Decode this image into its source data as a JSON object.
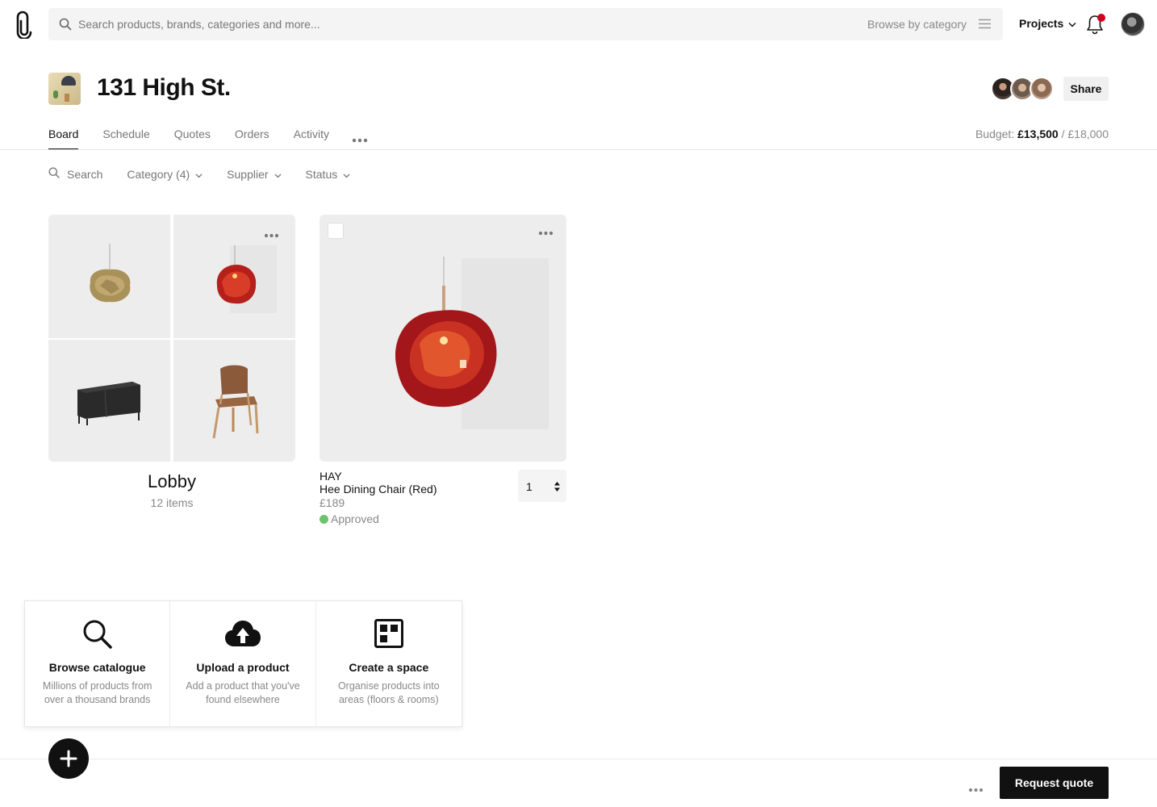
{
  "topbar": {
    "search_placeholder": "Search products, brands, categories and more...",
    "browse_label": "Browse by category",
    "projects_label": "Projects",
    "notification_dot_color": "#d0021b"
  },
  "project": {
    "title": "131 High St.",
    "share_label": "Share"
  },
  "tabs": [
    {
      "label": "Board",
      "active": true
    },
    {
      "label": "Schedule",
      "active": false
    },
    {
      "label": "Quotes",
      "active": false
    },
    {
      "label": "Orders",
      "active": false
    },
    {
      "label": "Activity",
      "active": false
    }
  ],
  "budget": {
    "label": "Budget:",
    "spent": "£13,500",
    "total": "/ £18,000"
  },
  "filters": {
    "search": "Search",
    "category": "Category (4)",
    "supplier": "Supplier",
    "status": "Status"
  },
  "lobby": {
    "title": "Lobby",
    "count": "12 items"
  },
  "product": {
    "brand": "HAY",
    "name": "Hee Dining Chair (Red)",
    "price": "£189",
    "status": "Approved",
    "status_color": "#6bc46b",
    "quantity": "1"
  },
  "actions": [
    {
      "title": "Browse catalogue",
      "desc": "Millions of products from over a thousand brands",
      "icon": "search-icon"
    },
    {
      "title": "Upload a product",
      "desc": "Add a product that you've found elsewhere",
      "icon": "cloud-upload-icon"
    },
    {
      "title": "Create a space",
      "desc": "Organise products into areas (floors & rooms)",
      "icon": "layout-grid-icon"
    }
  ],
  "bottom": {
    "request_quote_label": "Request quote"
  }
}
